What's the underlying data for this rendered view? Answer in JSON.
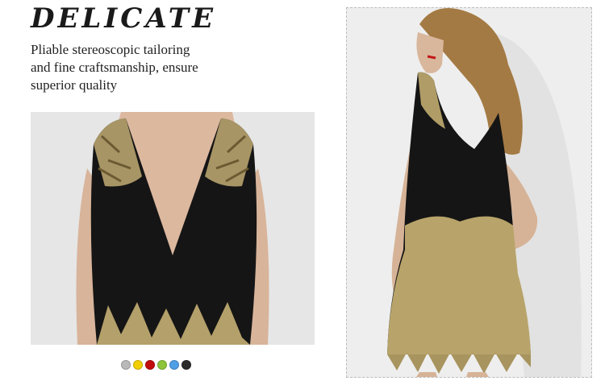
{
  "headline": "DELICATE",
  "tagline": {
    "lines": [
      "Pliable stereoscopic tailoring",
      "and fine craftsmanship, ensure",
      "superior quality"
    ]
  },
  "color_options": [
    {
      "name": "silver",
      "hex": "#b9b9b9"
    },
    {
      "name": "yellow",
      "hex": "#f2d000"
    },
    {
      "name": "red",
      "hex": "#c20d0d"
    },
    {
      "name": "green",
      "hex": "#8cc43a"
    },
    {
      "name": "blue",
      "hex": "#4f9fe6"
    },
    {
      "name": "black",
      "hex": "#2a2a2a"
    }
  ],
  "colors": {
    "dress": "#141414",
    "sequin_gold": "#b8a46a",
    "skin": "#d9b79c",
    "hair": "#a37a45",
    "photo_bg": "#e6e6e6"
  }
}
